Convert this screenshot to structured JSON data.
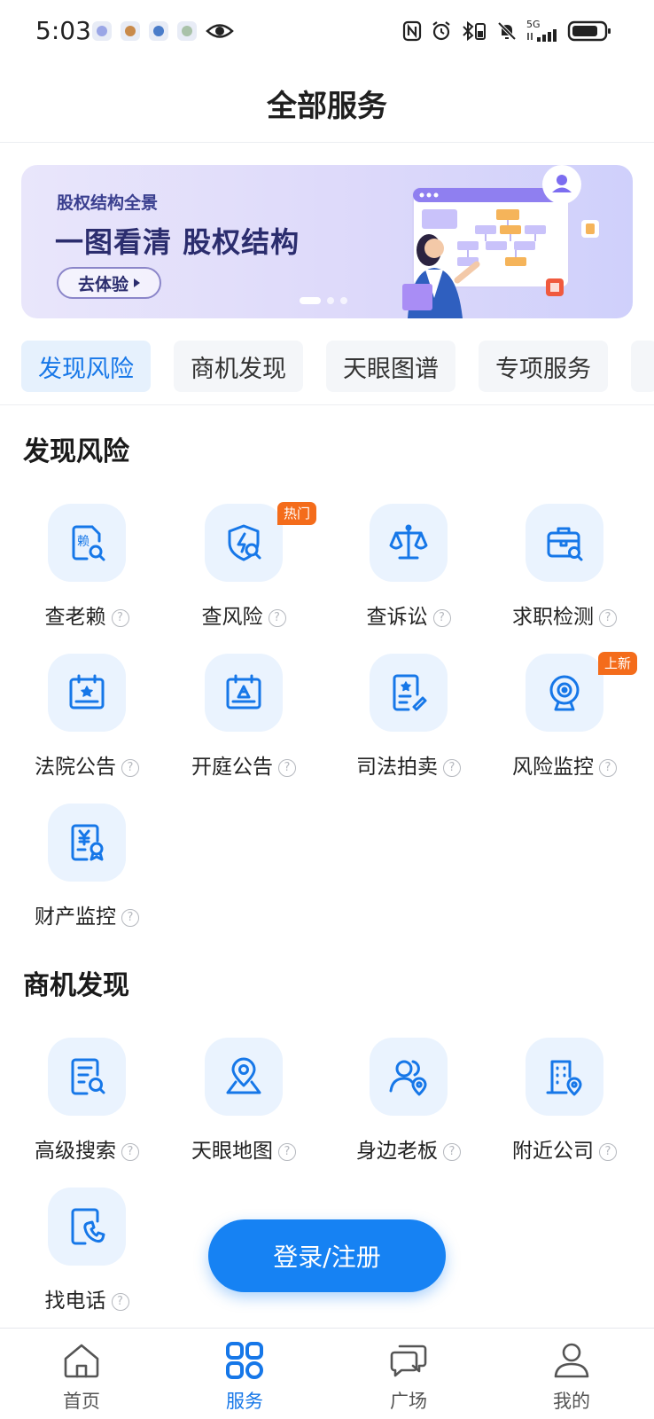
{
  "status_bar": {
    "time": "5:03",
    "network": "5G"
  },
  "header": {
    "title": "全部服务"
  },
  "banner": {
    "subtitle": "股权结构全景",
    "title": "一图看清 股权结构",
    "cta_label": "去体验"
  },
  "tabs": [
    {
      "label": "发现风险"
    },
    {
      "label": "商机发现"
    },
    {
      "label": "天眼图谱"
    },
    {
      "label": "专项服务"
    }
  ],
  "sections": [
    {
      "title": "发现风险",
      "items": [
        {
          "label": "查老赖",
          "icon": "debtor-search-icon",
          "help": "?"
        },
        {
          "label": "查风险",
          "icon": "shield-search-icon",
          "help": "?",
          "badge": "热门"
        },
        {
          "label": "查诉讼",
          "icon": "scale-icon",
          "help": "?"
        },
        {
          "label": "求职检测",
          "icon": "briefcase-search-icon",
          "help": "?"
        },
        {
          "label": "法院公告",
          "icon": "court-calendar-icon",
          "help": "?"
        },
        {
          "label": "开庭公告",
          "icon": "hearing-calendar-icon",
          "help": "?"
        },
        {
          "label": "司法拍卖",
          "icon": "auction-doc-icon",
          "help": "?"
        },
        {
          "label": "风险监控",
          "icon": "webcam-icon",
          "help": "?",
          "badge": "上新"
        },
        {
          "label": "财产监控",
          "icon": "asset-doc-icon",
          "help": "?"
        }
      ]
    },
    {
      "title": "商机发现",
      "items": [
        {
          "label": "高级搜索",
          "icon": "advanced-search-icon",
          "help": "?"
        },
        {
          "label": "天眼地图",
          "icon": "map-pin-icon",
          "help": "?"
        },
        {
          "label": "身边老板",
          "icon": "nearby-boss-icon",
          "help": "?"
        },
        {
          "label": "附近公司",
          "icon": "building-pin-icon",
          "help": "?"
        },
        {
          "label": "找电话",
          "icon": "phone-doc-icon",
          "help": "?"
        }
      ]
    }
  ],
  "login_button": {
    "label": "登录/注册"
  },
  "bottom_nav": [
    {
      "label": "首页",
      "icon": "home-icon"
    },
    {
      "label": "服务",
      "icon": "services-grid-icon",
      "active": true
    },
    {
      "label": "广场",
      "icon": "chat-bubbles-icon"
    },
    {
      "label": "我的",
      "icon": "profile-icon"
    }
  ],
  "colors": {
    "accent": "#1677e8",
    "badge": "#f46c1b",
    "tile_bg": "#eaf3fe"
  }
}
